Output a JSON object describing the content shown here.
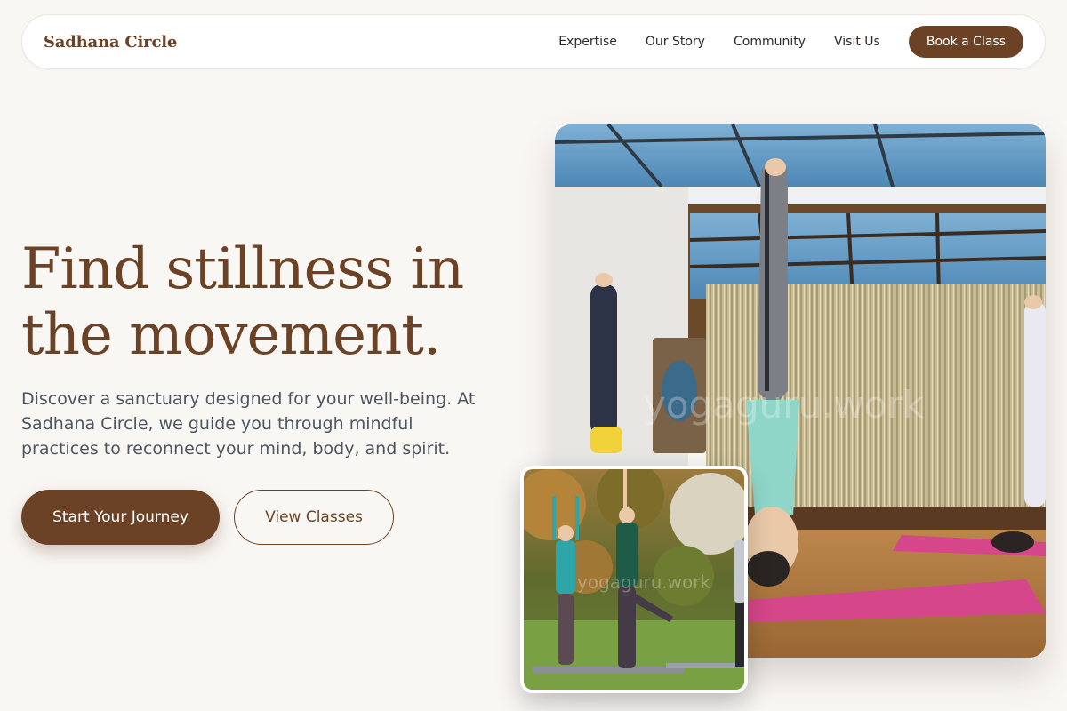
{
  "brand": {
    "name": "Sadhana Circle",
    "color": "#6b4226"
  },
  "nav": {
    "links": [
      "Expertise",
      "Our Story",
      "Community",
      "Visit Us"
    ],
    "cta_label": "Book a Class"
  },
  "hero": {
    "headline": "Find stillness in the movement.",
    "subtext": "Discover a sanctuary designed for your well-being. At Sadhana Circle, we guide you through mindful practices to reconnect your mind, body, and spirit.",
    "primary_button": "Start Your Journey",
    "secondary_button": "View Classes"
  },
  "images": {
    "main": {
      "watermark": "yogaguru.work",
      "subject": "indoor-headstand-class"
    },
    "secondary": {
      "watermark": "yogaguru.work",
      "subject": "outdoor-tree-pose-class"
    }
  },
  "colors": {
    "accent": "#6b4226",
    "background": "#f9f7f4",
    "body_text": "#4e5560",
    "mat_pink": "#d6468a"
  }
}
